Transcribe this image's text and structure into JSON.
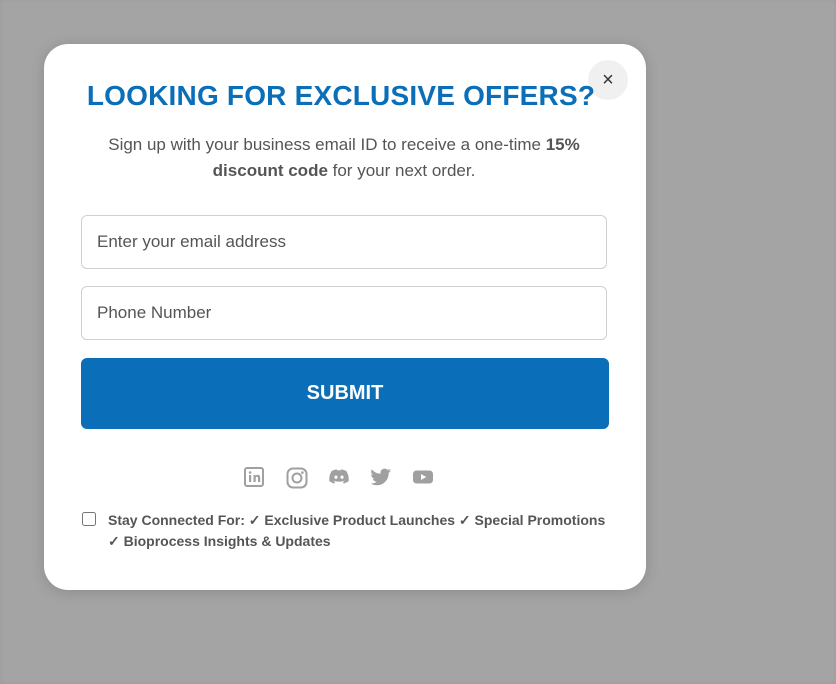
{
  "modal": {
    "title": "LOOKING FOR EXCLUSIVE OFFERS?",
    "subtitle_part1": "Sign up with your business email ID to receive a one-time ",
    "subtitle_bold": "15% discount code",
    "subtitle_part2": " for your next order.",
    "close_label": "×",
    "email_placeholder": "Enter your email address",
    "phone_placeholder": "Phone Number",
    "submit_label": "SUBMIT",
    "socials": [
      "linkedin-icon",
      "instagram-icon",
      "discord-icon",
      "twitter-icon",
      "youtube-icon"
    ],
    "consent_text": "Stay Connected For: ✓ Exclusive Product Launches ✓ Special Promotions ✓ Bioprocess Insights & Updates"
  },
  "colors": {
    "accent": "#0a6fb8",
    "icon_gray": "#a0a0a0"
  }
}
